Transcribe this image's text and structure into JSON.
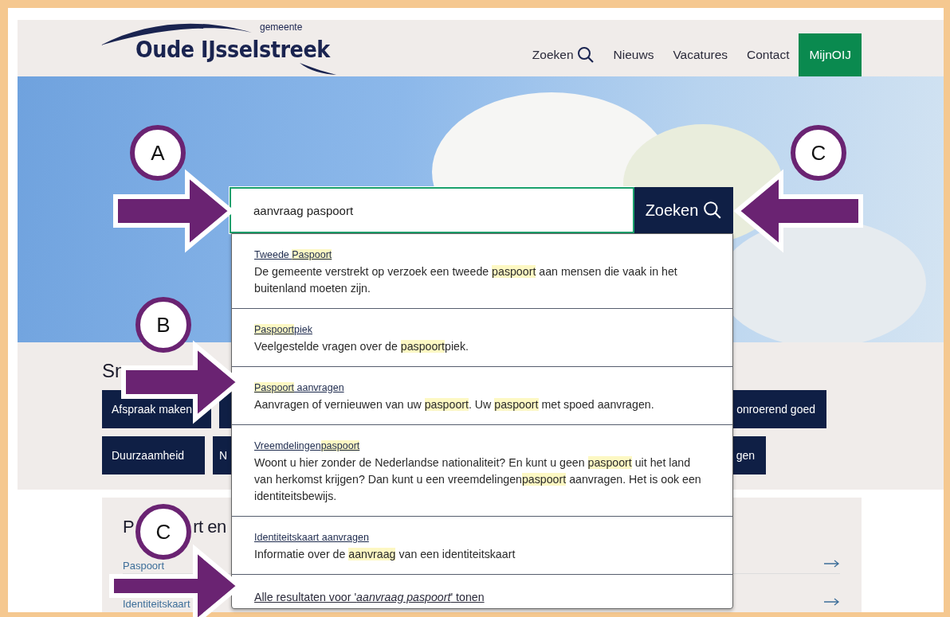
{
  "header": {
    "logo": {
      "small": "gemeente",
      "name": "Oude IJsselstreek"
    },
    "nav": [
      {
        "label": "Zoeken",
        "kind": "search"
      },
      {
        "label": "Nieuws",
        "kind": "link"
      },
      {
        "label": "Vacatures",
        "kind": "link"
      },
      {
        "label": "Contact",
        "kind": "link"
      },
      {
        "label": "MijnOIJ",
        "kind": "account"
      }
    ]
  },
  "search": {
    "value": "aanvraag paspoort",
    "button": "Zoeken",
    "results": [
      {
        "title": [
          {
            "text": "Tweede ",
            "highlight": false
          },
          {
            "text": "Paspoort",
            "highlight": true
          }
        ],
        "description": [
          {
            "text": "De gemeente verstrekt op verzoek een tweede ",
            "highlight": false
          },
          {
            "text": "paspoort",
            "highlight": true
          },
          {
            "text": " aan mensen die vaak in het buitenland moeten zijn.",
            "highlight": false
          }
        ]
      },
      {
        "title": [
          {
            "text": "Paspoort",
            "highlight": true
          },
          {
            "text": "piek",
            "highlight": false
          }
        ],
        "description": [
          {
            "text": "Veelgestelde vragen over de ",
            "highlight": false
          },
          {
            "text": "paspoort",
            "highlight": true
          },
          {
            "text": "piek.",
            "highlight": false
          }
        ]
      },
      {
        "title": [
          {
            "text": "Paspoort",
            "highlight": true
          },
          {
            "text": " aanvragen",
            "highlight": false
          }
        ],
        "description": [
          {
            "text": "Aanvragen of vernieuwen van uw ",
            "highlight": false
          },
          {
            "text": "paspoort",
            "highlight": true
          },
          {
            "text": ". Uw ",
            "highlight": false
          },
          {
            "text": "paspoort",
            "highlight": true
          },
          {
            "text": " met spoed aanvragen.",
            "highlight": false
          }
        ]
      },
      {
        "title": [
          {
            "text": "Vreemdelingen",
            "highlight": false
          },
          {
            "text": "paspoort",
            "highlight": true
          }
        ],
        "description": [
          {
            "text": "Woont u hier zonder de Nederlandse nationaliteit? En kunt u geen ",
            "highlight": false
          },
          {
            "text": "paspoort",
            "highlight": true
          },
          {
            "text": " uit het land van herkomst krijgen? Dan kunt u een vreemdelingen",
            "highlight": false
          },
          {
            "text": "paspoort",
            "highlight": true
          },
          {
            "text": " aanvragen. Het is ook een identiteitsbewijs.",
            "highlight": false
          }
        ]
      },
      {
        "title": [
          {
            "text": "Identiteitskaart aanvragen",
            "highlight": false
          }
        ],
        "description": [
          {
            "text": "Informatie over de ",
            "highlight": false
          },
          {
            "text": "aanvraag",
            "highlight": true
          },
          {
            "text": " van een identiteitskaart",
            "highlight": false
          }
        ]
      }
    ],
    "all_results": "Alle resultaten voor '*aanvraag paspoort*' tonen"
  },
  "quick_links": {
    "heading": "Sn",
    "buttons": [
      "Afspraak maken",
      "onroerend goed",
      "Duurzaamheid",
      "N",
      "gen"
    ]
  },
  "section": {
    "heading_parts": [
      "P",
      "rt en"
    ],
    "links": [
      "Paspoort",
      "Identiteitskaart"
    ]
  },
  "annotations": [
    {
      "label": "A"
    },
    {
      "label": "C"
    },
    {
      "label": "B"
    },
    {
      "label": "C"
    }
  ]
}
